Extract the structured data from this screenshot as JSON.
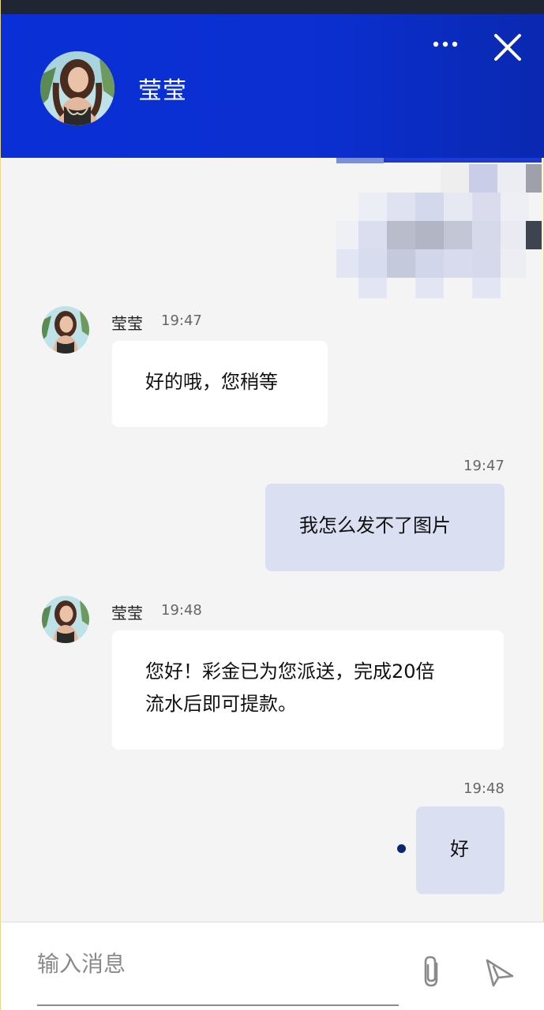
{
  "header": {
    "contact_name": "莹莹",
    "more_icon": "more-horizontal-icon",
    "close_icon": "close-icon"
  },
  "colors": {
    "header_bg": "#0a2fd6",
    "incoming_bubble": "#ffffff",
    "outgoing_bubble": "#dadff1",
    "chat_bg": "#f4f4f4"
  },
  "messages": [
    {
      "direction": "in",
      "sender": "莹莹",
      "time": "19:47",
      "text": "好的哦，您稍等"
    },
    {
      "direction": "out",
      "time": "19:47",
      "text": "我怎么发不了图片"
    },
    {
      "direction": "in",
      "sender": "莹莹",
      "time": "19:48",
      "lines": [
        "您好！彩金已为您派送，完成20倍",
        "流水后即可提款。"
      ]
    },
    {
      "direction": "out",
      "time": "19:48",
      "text": "好"
    }
  ],
  "composer": {
    "placeholder": "输入消息",
    "attach_icon": "paperclip-icon",
    "send_icon": "send-icon"
  }
}
